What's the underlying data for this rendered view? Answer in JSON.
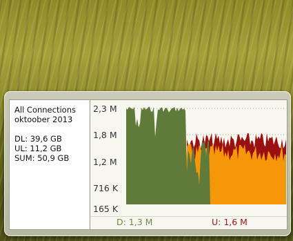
{
  "gadget": {
    "title": "All Connections",
    "period": "oktoober 2013",
    "stats": [
      {
        "label": "DL:",
        "value": "39,6 GB"
      },
      {
        "label": "UL:",
        "value": "11,2 GB"
      },
      {
        "label": "SUM:",
        "value": "50,9 GB"
      }
    ],
    "y_ticks": [
      "2,3 M",
      "1,8 M",
      "1,2 M",
      "716 K",
      "165 K"
    ],
    "legend": {
      "download": "D: 1,3 M",
      "upload": "U: 1,6 M"
    },
    "colors": {
      "download_fill": "#5f7a39",
      "upload_fill": "#f4980a",
      "peak_fill": "#9a1010",
      "download_text": "#6e8a4a",
      "upload_text": "#a01a1a"
    }
  }
}
